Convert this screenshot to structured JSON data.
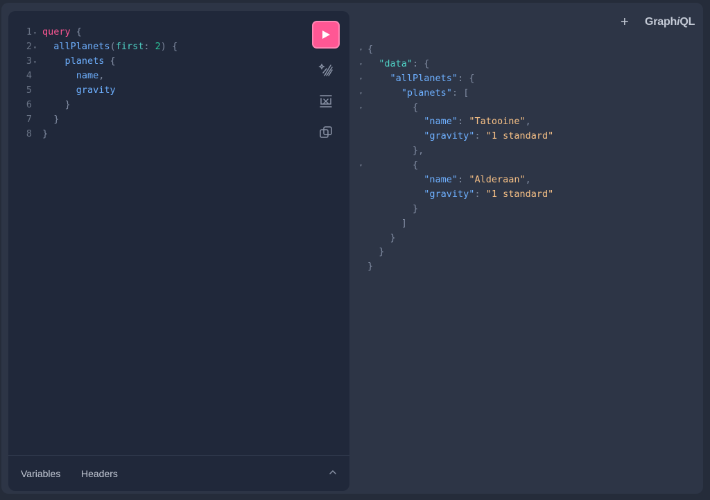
{
  "header": {
    "new_tab_label": "+",
    "logo_prefix": "Graph",
    "logo_italic": "i",
    "logo_suffix": "QL"
  },
  "editor": {
    "lines": [
      {
        "n": "1",
        "fold": true,
        "indent": "",
        "parts": [
          {
            "t": "query",
            "c": "kw"
          },
          {
            "t": " {",
            "c": "pun"
          }
        ]
      },
      {
        "n": "2",
        "fold": true,
        "indent": "  ",
        "parts": [
          {
            "t": "allPlanets",
            "c": "fld"
          },
          {
            "t": "(",
            "c": "pun"
          },
          {
            "t": "first",
            "c": "arg"
          },
          {
            "t": ": ",
            "c": "pun"
          },
          {
            "t": "2",
            "c": "num"
          },
          {
            "t": ") {",
            "c": "pun"
          }
        ]
      },
      {
        "n": "3",
        "fold": true,
        "indent": "    ",
        "parts": [
          {
            "t": "planets",
            "c": "fld"
          },
          {
            "t": " {",
            "c": "pun"
          }
        ]
      },
      {
        "n": "4",
        "fold": false,
        "indent": "      ",
        "parts": [
          {
            "t": "name",
            "c": "fld"
          },
          {
            "t": ",",
            "c": "pun"
          }
        ]
      },
      {
        "n": "5",
        "fold": false,
        "indent": "      ",
        "parts": [
          {
            "t": "gravity",
            "c": "fld"
          }
        ]
      },
      {
        "n": "6",
        "fold": false,
        "indent": "    ",
        "parts": [
          {
            "t": "}",
            "c": "pun"
          }
        ]
      },
      {
        "n": "7",
        "fold": false,
        "indent": "  ",
        "parts": [
          {
            "t": "}",
            "c": "pun"
          }
        ]
      },
      {
        "n": "8",
        "fold": false,
        "indent": "",
        "parts": [
          {
            "t": "}",
            "c": "pun"
          }
        ]
      }
    ],
    "tools": {
      "run": "play-icon",
      "prettify": "prettify-icon",
      "merge": "merge-fragments-icon",
      "copy": "copy-icon"
    },
    "footer": {
      "variables_tab": "Variables",
      "headers_tab": "Headers"
    }
  },
  "result": {
    "lines": [
      {
        "fold": true,
        "indent": "",
        "parts": [
          {
            "t": "{",
            "c": "pun"
          }
        ]
      },
      {
        "fold": true,
        "indent": "  ",
        "parts": [
          {
            "t": "\"data\"",
            "c": "key2"
          },
          {
            "t": ": {",
            "c": "pun"
          }
        ]
      },
      {
        "fold": true,
        "indent": "    ",
        "parts": [
          {
            "t": "\"allPlanets\"",
            "c": "key"
          },
          {
            "t": ": {",
            "c": "pun"
          }
        ]
      },
      {
        "fold": true,
        "indent": "      ",
        "parts": [
          {
            "t": "\"planets\"",
            "c": "key"
          },
          {
            "t": ": [",
            "c": "pun"
          }
        ]
      },
      {
        "fold": true,
        "indent": "        ",
        "parts": [
          {
            "t": "{",
            "c": "pun"
          }
        ]
      },
      {
        "fold": false,
        "indent": "          ",
        "parts": [
          {
            "t": "\"name\"",
            "c": "key"
          },
          {
            "t": ": ",
            "c": "pun"
          },
          {
            "t": "\"Tatooine\"",
            "c": "str"
          },
          {
            "t": ",",
            "c": "pun"
          }
        ]
      },
      {
        "fold": false,
        "indent": "          ",
        "parts": [
          {
            "t": "\"gravity\"",
            "c": "key"
          },
          {
            "t": ": ",
            "c": "pun"
          },
          {
            "t": "\"1 standard\"",
            "c": "str"
          }
        ]
      },
      {
        "fold": false,
        "indent": "        ",
        "parts": [
          {
            "t": "},",
            "c": "pun"
          }
        ]
      },
      {
        "fold": true,
        "indent": "        ",
        "parts": [
          {
            "t": "{",
            "c": "pun"
          }
        ]
      },
      {
        "fold": false,
        "indent": "          ",
        "parts": [
          {
            "t": "\"name\"",
            "c": "key"
          },
          {
            "t": ": ",
            "c": "pun"
          },
          {
            "t": "\"Alderaan\"",
            "c": "str"
          },
          {
            "t": ",",
            "c": "pun"
          }
        ]
      },
      {
        "fold": false,
        "indent": "          ",
        "parts": [
          {
            "t": "\"gravity\"",
            "c": "key"
          },
          {
            "t": ": ",
            "c": "pun"
          },
          {
            "t": "\"1 standard\"",
            "c": "str"
          }
        ]
      },
      {
        "fold": false,
        "indent": "        ",
        "parts": [
          {
            "t": "}",
            "c": "pun"
          }
        ]
      },
      {
        "fold": false,
        "indent": "      ",
        "parts": [
          {
            "t": "]",
            "c": "pun"
          }
        ]
      },
      {
        "fold": false,
        "indent": "    ",
        "parts": [
          {
            "t": "}",
            "c": "pun"
          }
        ]
      },
      {
        "fold": false,
        "indent": "  ",
        "parts": [
          {
            "t": "}",
            "c": "pun"
          }
        ]
      },
      {
        "fold": false,
        "indent": "",
        "parts": [
          {
            "t": "}",
            "c": "pun"
          }
        ]
      }
    ]
  },
  "colors": {
    "accent": "#ff5794",
    "background": "#2d3546",
    "editor_bg": "#20283a"
  }
}
